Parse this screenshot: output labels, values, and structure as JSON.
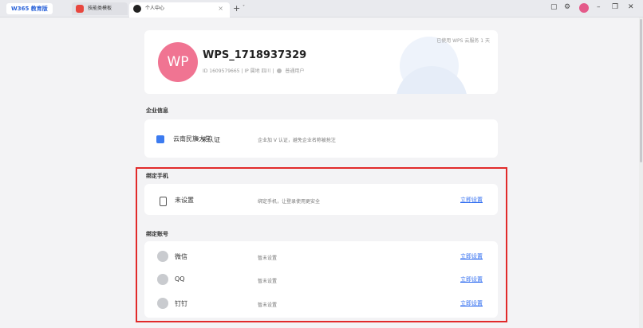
{
  "tabbar": {
    "logo": "W365 教育版",
    "tabs": [
      {
        "label": "技能类模板"
      },
      {
        "label": "个人中心",
        "close": "×"
      }
    ],
    "new_tab": "+",
    "new_tab_dropdown": "˅",
    "controls": {
      "box": "▢",
      "settings": "⚙",
      "minimize": "–",
      "restore": "❐",
      "close": "✕"
    }
  },
  "profile": {
    "avatar_text": "WP",
    "username": "WPS_1718937329",
    "id": "ID 1609579665",
    "ip": "IP 属地 四川",
    "role": "普通用户",
    "service": "已使用 WPS 云服务 1 天"
  },
  "enterprise": {
    "section_title": "企业信息",
    "org_name": "云南民族大学",
    "status": "未认证",
    "hint": "企业加 V 认证，避免企业名称被抢注"
  },
  "phone": {
    "section_title": "绑定手机",
    "label": "未设置",
    "hint": "绑定手机，让登录使用更安全",
    "action": "立即设置"
  },
  "accounts": {
    "section_title": "绑定账号",
    "items": [
      {
        "name": "微信",
        "status": "暂未设置",
        "action": "立即设置",
        "icon": "wechat-icon"
      },
      {
        "name": "QQ",
        "status": "暂未设置",
        "action": "立即设置",
        "icon": "qq-icon"
      },
      {
        "name": "钉钉",
        "status": "暂未设置",
        "action": "立即设置",
        "icon": "dingtalk-icon"
      }
    ]
  }
}
